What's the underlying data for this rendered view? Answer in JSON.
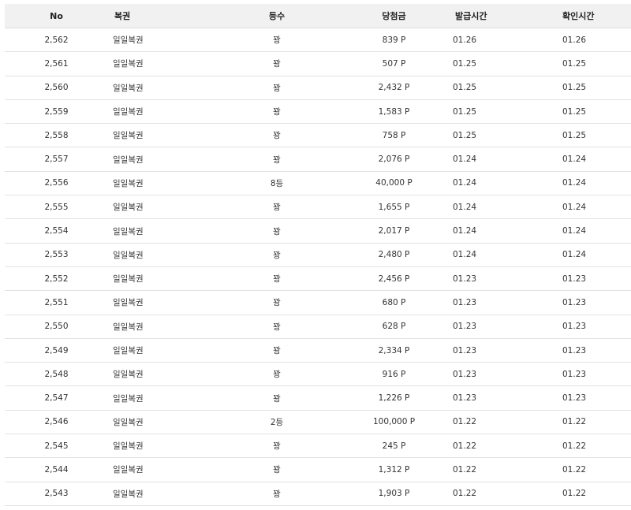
{
  "table": {
    "headers": {
      "no": "No",
      "lottery": "복권",
      "rank": "등수",
      "prize": "당첨금",
      "issued": "발급시간",
      "checked": "확인시간"
    },
    "rows": [
      {
        "no": "2,562",
        "lottery": "일일복권",
        "rank": "꽝",
        "prize": "839 P",
        "issued": "01.26",
        "checked": "01.26"
      },
      {
        "no": "2,561",
        "lottery": "일일복권",
        "rank": "꽝",
        "prize": "507 P",
        "issued": "01.25",
        "checked": "01.25"
      },
      {
        "no": "2,560",
        "lottery": "일일복권",
        "rank": "꽝",
        "prize": "2,432 P",
        "issued": "01.25",
        "checked": "01.25"
      },
      {
        "no": "2,559",
        "lottery": "일일복권",
        "rank": "꽝",
        "prize": "1,583 P",
        "issued": "01.25",
        "checked": "01.25"
      },
      {
        "no": "2,558",
        "lottery": "일일복권",
        "rank": "꽝",
        "prize": "758 P",
        "issued": "01.25",
        "checked": "01.25"
      },
      {
        "no": "2,557",
        "lottery": "일일복권",
        "rank": "꽝",
        "prize": "2,076 P",
        "issued": "01.24",
        "checked": "01.24"
      },
      {
        "no": "2,556",
        "lottery": "일일복권",
        "rank": "8등",
        "prize": "40,000 P",
        "issued": "01.24",
        "checked": "01.24"
      },
      {
        "no": "2,555",
        "lottery": "일일복권",
        "rank": "꽝",
        "prize": "1,655 P",
        "issued": "01.24",
        "checked": "01.24"
      },
      {
        "no": "2,554",
        "lottery": "일일복권",
        "rank": "꽝",
        "prize": "2,017 P",
        "issued": "01.24",
        "checked": "01.24"
      },
      {
        "no": "2,553",
        "lottery": "일일복권",
        "rank": "꽝",
        "prize": "2,480 P",
        "issued": "01.24",
        "checked": "01.24"
      },
      {
        "no": "2,552",
        "lottery": "일일복권",
        "rank": "꽝",
        "prize": "2,456 P",
        "issued": "01.23",
        "checked": "01.23"
      },
      {
        "no": "2,551",
        "lottery": "일일복권",
        "rank": "꽝",
        "prize": "680 P",
        "issued": "01.23",
        "checked": "01.23"
      },
      {
        "no": "2,550",
        "lottery": "일일복권",
        "rank": "꽝",
        "prize": "628 P",
        "issued": "01.23",
        "checked": "01.23"
      },
      {
        "no": "2,549",
        "lottery": "일일복권",
        "rank": "꽝",
        "prize": "2,334 P",
        "issued": "01.23",
        "checked": "01.23"
      },
      {
        "no": "2,548",
        "lottery": "일일복권",
        "rank": "꽝",
        "prize": "916 P",
        "issued": "01.23",
        "checked": "01.23"
      },
      {
        "no": "2,547",
        "lottery": "일일복권",
        "rank": "꽝",
        "prize": "1,226 P",
        "issued": "01.23",
        "checked": "01.23"
      },
      {
        "no": "2,546",
        "lottery": "일일복권",
        "rank": "2등",
        "prize": "100,000 P",
        "issued": "01.22",
        "checked": "01.22"
      },
      {
        "no": "2,545",
        "lottery": "일일복권",
        "rank": "꽝",
        "prize": "245 P",
        "issued": "01.22",
        "checked": "01.22"
      },
      {
        "no": "2,544",
        "lottery": "일일복권",
        "rank": "꽝",
        "prize": "1,312 P",
        "issued": "01.22",
        "checked": "01.22"
      },
      {
        "no": "2,543",
        "lottery": "일일복권",
        "rank": "꽝",
        "prize": "1,903 P",
        "issued": "01.22",
        "checked": "01.22"
      }
    ]
  }
}
